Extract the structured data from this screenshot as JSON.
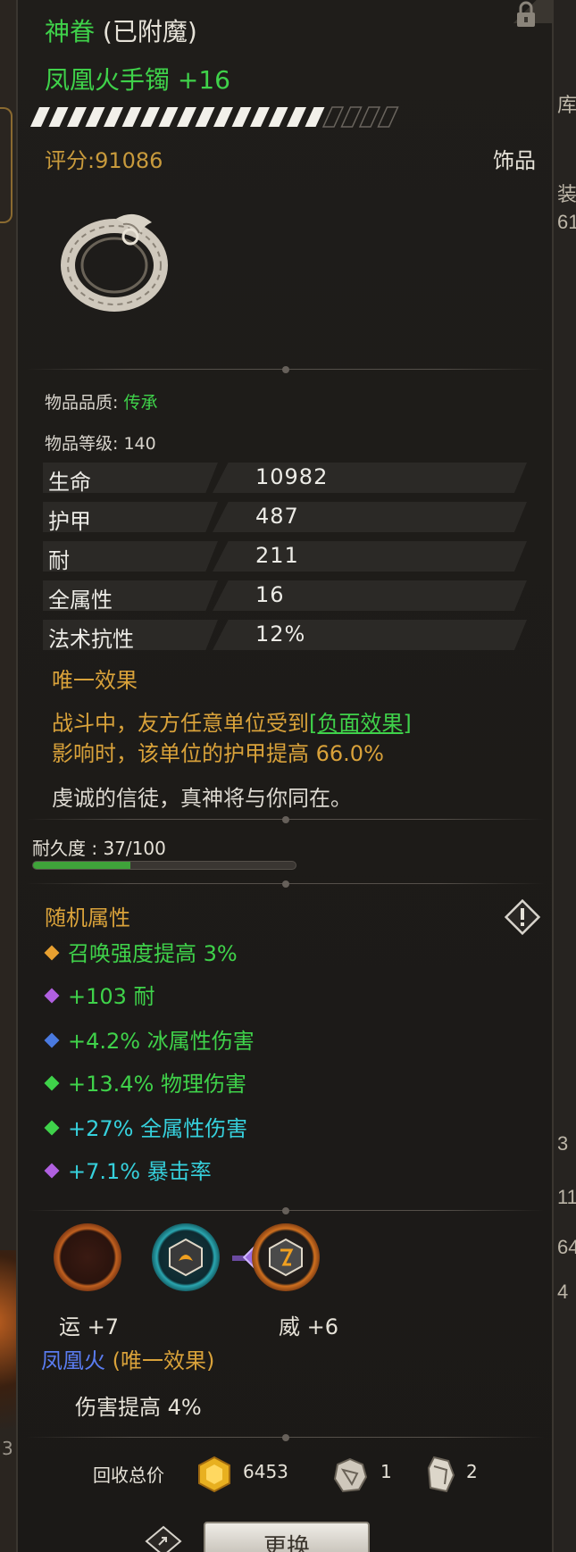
{
  "background": {
    "right_edge_text": [
      "库",
      "装",
      "61",
      "3",
      "11",
      "64",
      "4"
    ],
    "left_edge_text": [
      "3"
    ]
  },
  "item": {
    "title_prefix": "神眷",
    "title_suffix": "(已附魔)",
    "name": "凤凰火手镯 +16",
    "score": "评分:91086",
    "category": "饰品",
    "quality_label": "物品品质: ",
    "quality_value": "传承",
    "level_text": "物品等级: 140",
    "upgrade_progress": 0.8
  },
  "stats": [
    {
      "label": "生命",
      "value": "10982"
    },
    {
      "label": "护甲",
      "value": "487"
    },
    {
      "label": "耐",
      "value": "211"
    },
    {
      "label": "全属性",
      "value": "16"
    },
    {
      "label": "法术抗性",
      "value": "12%"
    }
  ],
  "unique": {
    "title": "唯一效果",
    "desc_line1_pre": "战斗中，友方任意单位受到",
    "desc_keyword": "[负面效果]",
    "desc_line2": "影响时，该单位的护甲提高 66.0%",
    "flavor": "虔诚的信徒，真神将与你同在。"
  },
  "durability": {
    "label": "耐久度 : 37/100",
    "current": 37,
    "max": 100
  },
  "random_attrs": {
    "title": "随机属性",
    "items": [
      {
        "text": "召唤强度提高 3%",
        "gem_color": "#e8a030",
        "color": "green"
      },
      {
        "text": "+103 耐",
        "gem_color": "#b060e0",
        "color": "green"
      },
      {
        "text": "+4.2% 冰属性伤害",
        "gem_color": "#4a7ae0",
        "color": "green"
      },
      {
        "text": "+13.4% 物理伤害",
        "gem_color": "#3fd24a",
        "color": "green"
      },
      {
        "text": "+27% 全属性伤害",
        "gem_color": "#3fd24a",
        "color": "cyan"
      },
      {
        "text": "+7.1% 暴击率",
        "gem_color": "#b060e0",
        "color": "cyan"
      }
    ]
  },
  "sockets": {
    "label_left": "运 +7",
    "label_right": "威 +6"
  },
  "set": {
    "name_blue": "凤凰火",
    "name_rest": " (唯一效果)",
    "bonus": "伤害提高 4%"
  },
  "recycle": {
    "label": "回收总价",
    "gold": "6453",
    "stone": "1",
    "crystal": "2"
  },
  "buttons": {
    "swap": "更换"
  },
  "colors": {
    "green": "#3fd24a",
    "gold": "#d9a23a",
    "cyan": "#36d0dc",
    "blue": "#5a7cf0"
  }
}
